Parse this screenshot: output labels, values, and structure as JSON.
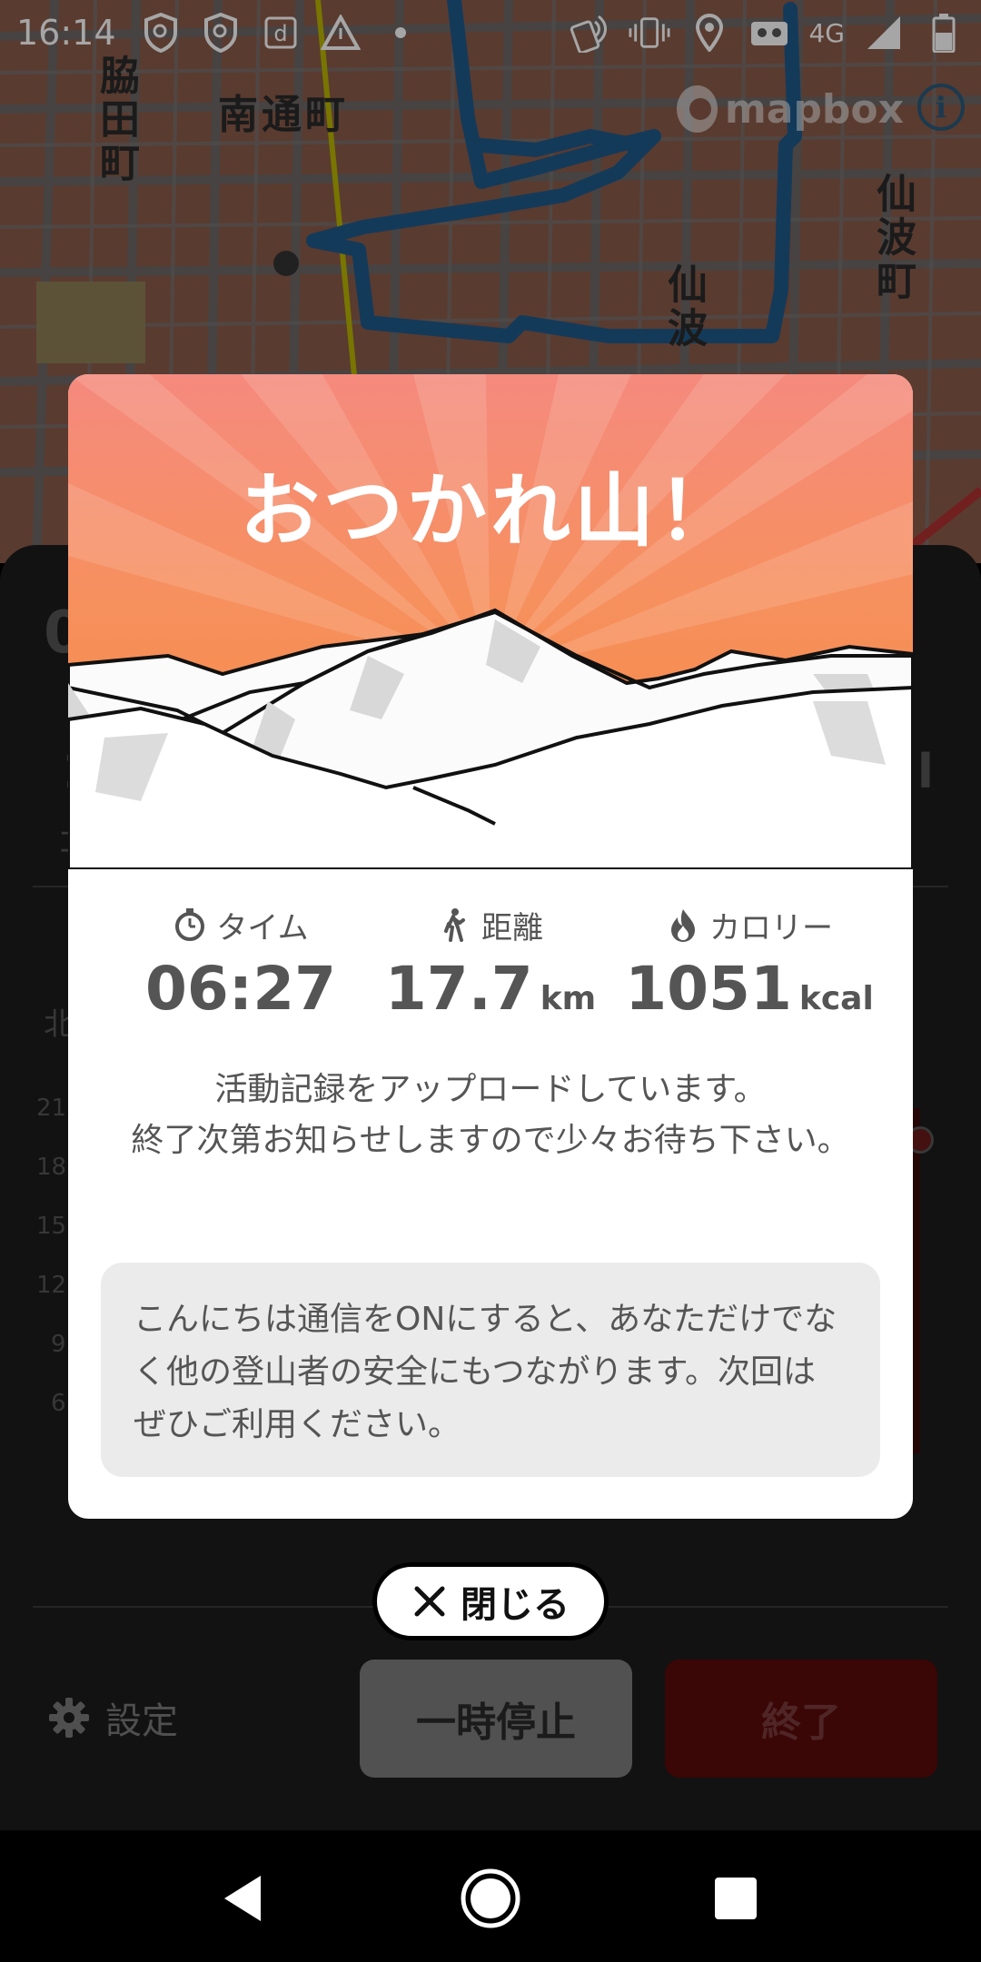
{
  "status_bar": {
    "time": "16:14",
    "network": "4G",
    "left_icons": [
      "shield-search-icon",
      "shield-search-icon",
      "docomo-d-icon",
      "warning-icon",
      "dot-icon"
    ],
    "right_icons": [
      "nfc-icon",
      "vibrate-icon",
      "location-icon",
      "vr-icon",
      "signal-icon",
      "battery-icon"
    ]
  },
  "map": {
    "attribution": "mapbox",
    "labels": {
      "minami_dori": "南通町",
      "wakita": "脇田町",
      "senba1": "仙波町",
      "senba2": "仙波"
    }
  },
  "background": {
    "peek_top": "0",
    "peek_mid": "1",
    "peek_small": "コ",
    "peek_right": "l",
    "peek_north": "北",
    "peek_axis": [
      "21",
      "18",
      "15",
      "12",
      "9",
      "6"
    ],
    "settings_label": "設定",
    "pause_label": "一時停止",
    "end_label": "終了"
  },
  "modal": {
    "title": "おつかれ山！",
    "stats": [
      {
        "label": "タイム",
        "value": "06:27",
        "unit": "",
        "icon": "stopwatch-icon"
      },
      {
        "label": "距離",
        "value": "17.7",
        "unit": "km",
        "icon": "hiker-icon"
      },
      {
        "label": "カロリー",
        "value": "1051",
        "unit": "kcal",
        "icon": "flame-icon"
      }
    ],
    "upload_line1": "活動記録をアップロードしています。",
    "upload_line2": "終了次第お知らせしますので少々お待ち下さい。",
    "info_text": "こんにちは通信をONにすると、あなただけでなく他の登山者の安全にもつながります。次回はぜひご利用ください。"
  },
  "close_label": "閉じる",
  "colors": {
    "hero_top": "#f58a7e",
    "hero_bottom": "#f7873d",
    "route": "#1f5a8a",
    "end_button": "#5a0a0a",
    "pause_button": "#7d7d7d"
  }
}
